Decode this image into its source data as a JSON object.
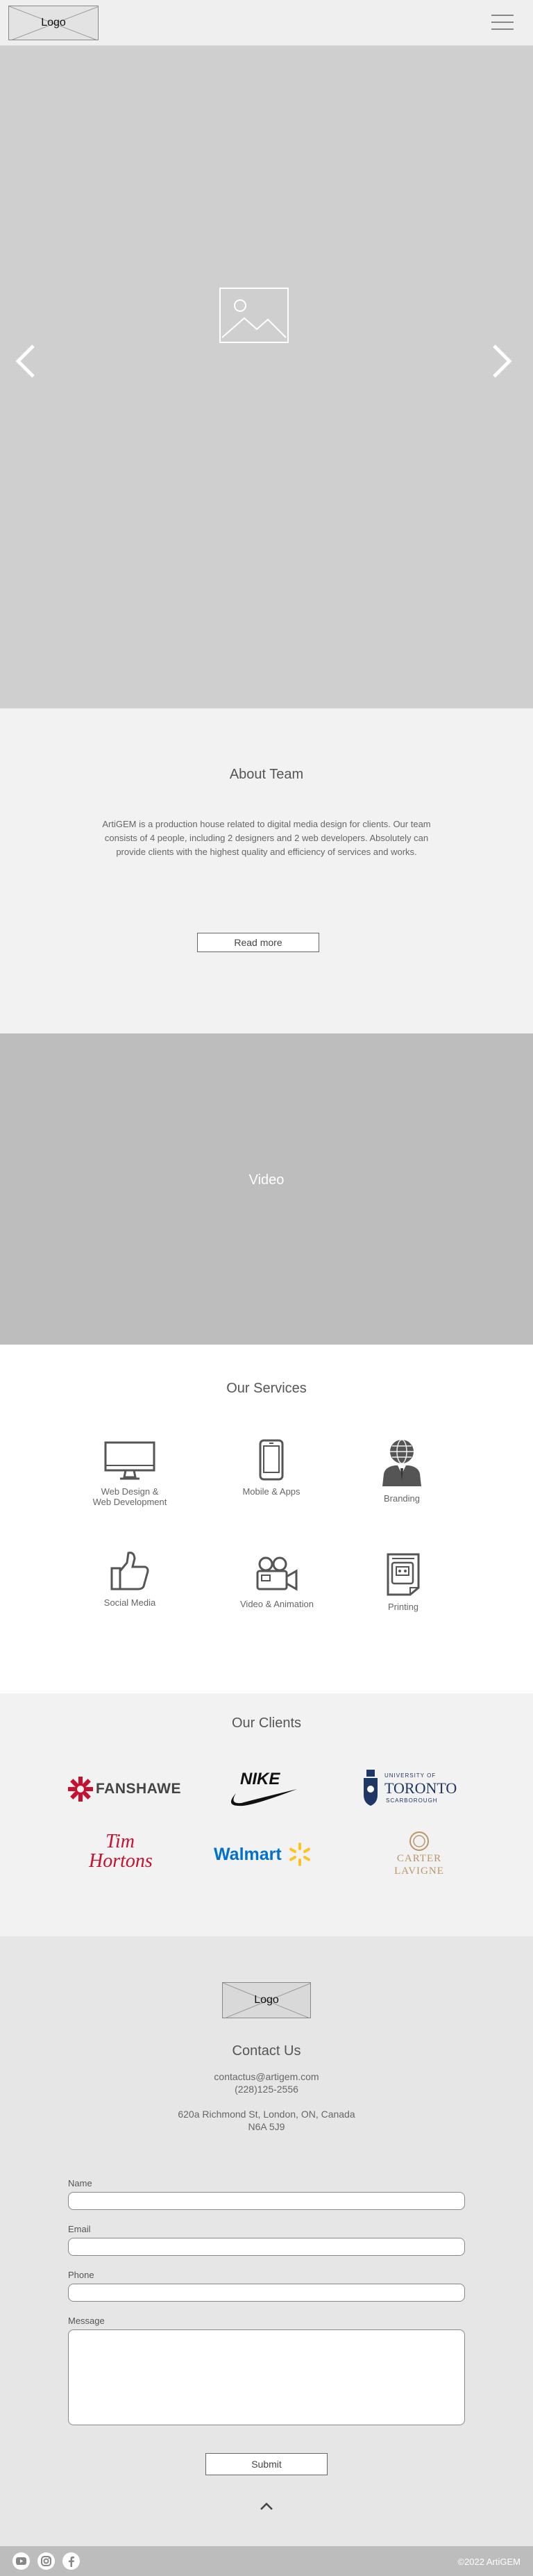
{
  "header": {
    "logo_text": "Logo",
    "menu_icon": "hamburger-icon"
  },
  "hero": {
    "image_icon": "image-placeholder-icon",
    "prev_icon": "chevron-left-icon",
    "next_icon": "chevron-right-icon"
  },
  "about": {
    "title": "About Team",
    "text": "ArtiGEM is a production house related to digital media design for clients. Our team consists of 4 people, including 2 designers and 2 web developers. Absolutely can provide clients with the highest quality and efficiency of services and works.",
    "button_label": "Read more"
  },
  "video": {
    "label": "Video"
  },
  "services": {
    "title": "Our Services",
    "items": [
      {
        "label": "Web Design &\nWeb Development",
        "icon": "monitor-icon"
      },
      {
        "label": "Mobile & Apps",
        "icon": "smartphone-icon"
      },
      {
        "label": "Branding",
        "icon": "businessman-globe-icon"
      },
      {
        "label": "Social Media",
        "icon": "thumbs-up-icon"
      },
      {
        "label": "Video & Animation",
        "icon": "video-camera-icon"
      },
      {
        "label": "Printing",
        "icon": "printed-document-icon"
      }
    ]
  },
  "clients": {
    "title": "Our Clients",
    "logos": {
      "fanshawe": "FANSHAWE",
      "nike": "NIKE",
      "toronto_small": "UNIVERSITY OF",
      "toronto_big": "TORONTO",
      "toronto_sub": "SCARBOROUGH",
      "tim_1": "Tim",
      "tim_2": "Hortons",
      "walmart": "Walmart",
      "carter_1": "CARTER",
      "carter_2": "LAVIGNE"
    }
  },
  "contact": {
    "logo_text": "Logo",
    "title": "Contact Us",
    "email": "contactus@artigem.com",
    "phone": "(228)125-2556",
    "address_1": "620a Richmond St, London, ON, Canada",
    "address_2": "N6A 5J9",
    "form": {
      "name_label": "Name",
      "email_label": "Email",
      "phone_label": "Phone",
      "message_label": "Message",
      "submit_label": "Submit"
    }
  },
  "footer": {
    "social_icons": [
      "youtube-icon",
      "instagram-icon",
      "facebook-icon"
    ],
    "copyright": "©2022 ArtiGEM"
  },
  "colors": {
    "header_bg": "#efefef",
    "hero_bg": "#cfcfcf",
    "about_bg": "#f2f2f2",
    "video_bg": "#bdbdbd",
    "contact_bg": "#e6e6e6",
    "footer_bg": "#bdbdbd",
    "fanshawe_red": "#c8102e",
    "tim_red": "#c8102e",
    "walmart_blue": "#0071ce",
    "walmart_yellow": "#ffc220",
    "toronto_navy": "#1e3765",
    "carter_gold": "#b8976a"
  }
}
